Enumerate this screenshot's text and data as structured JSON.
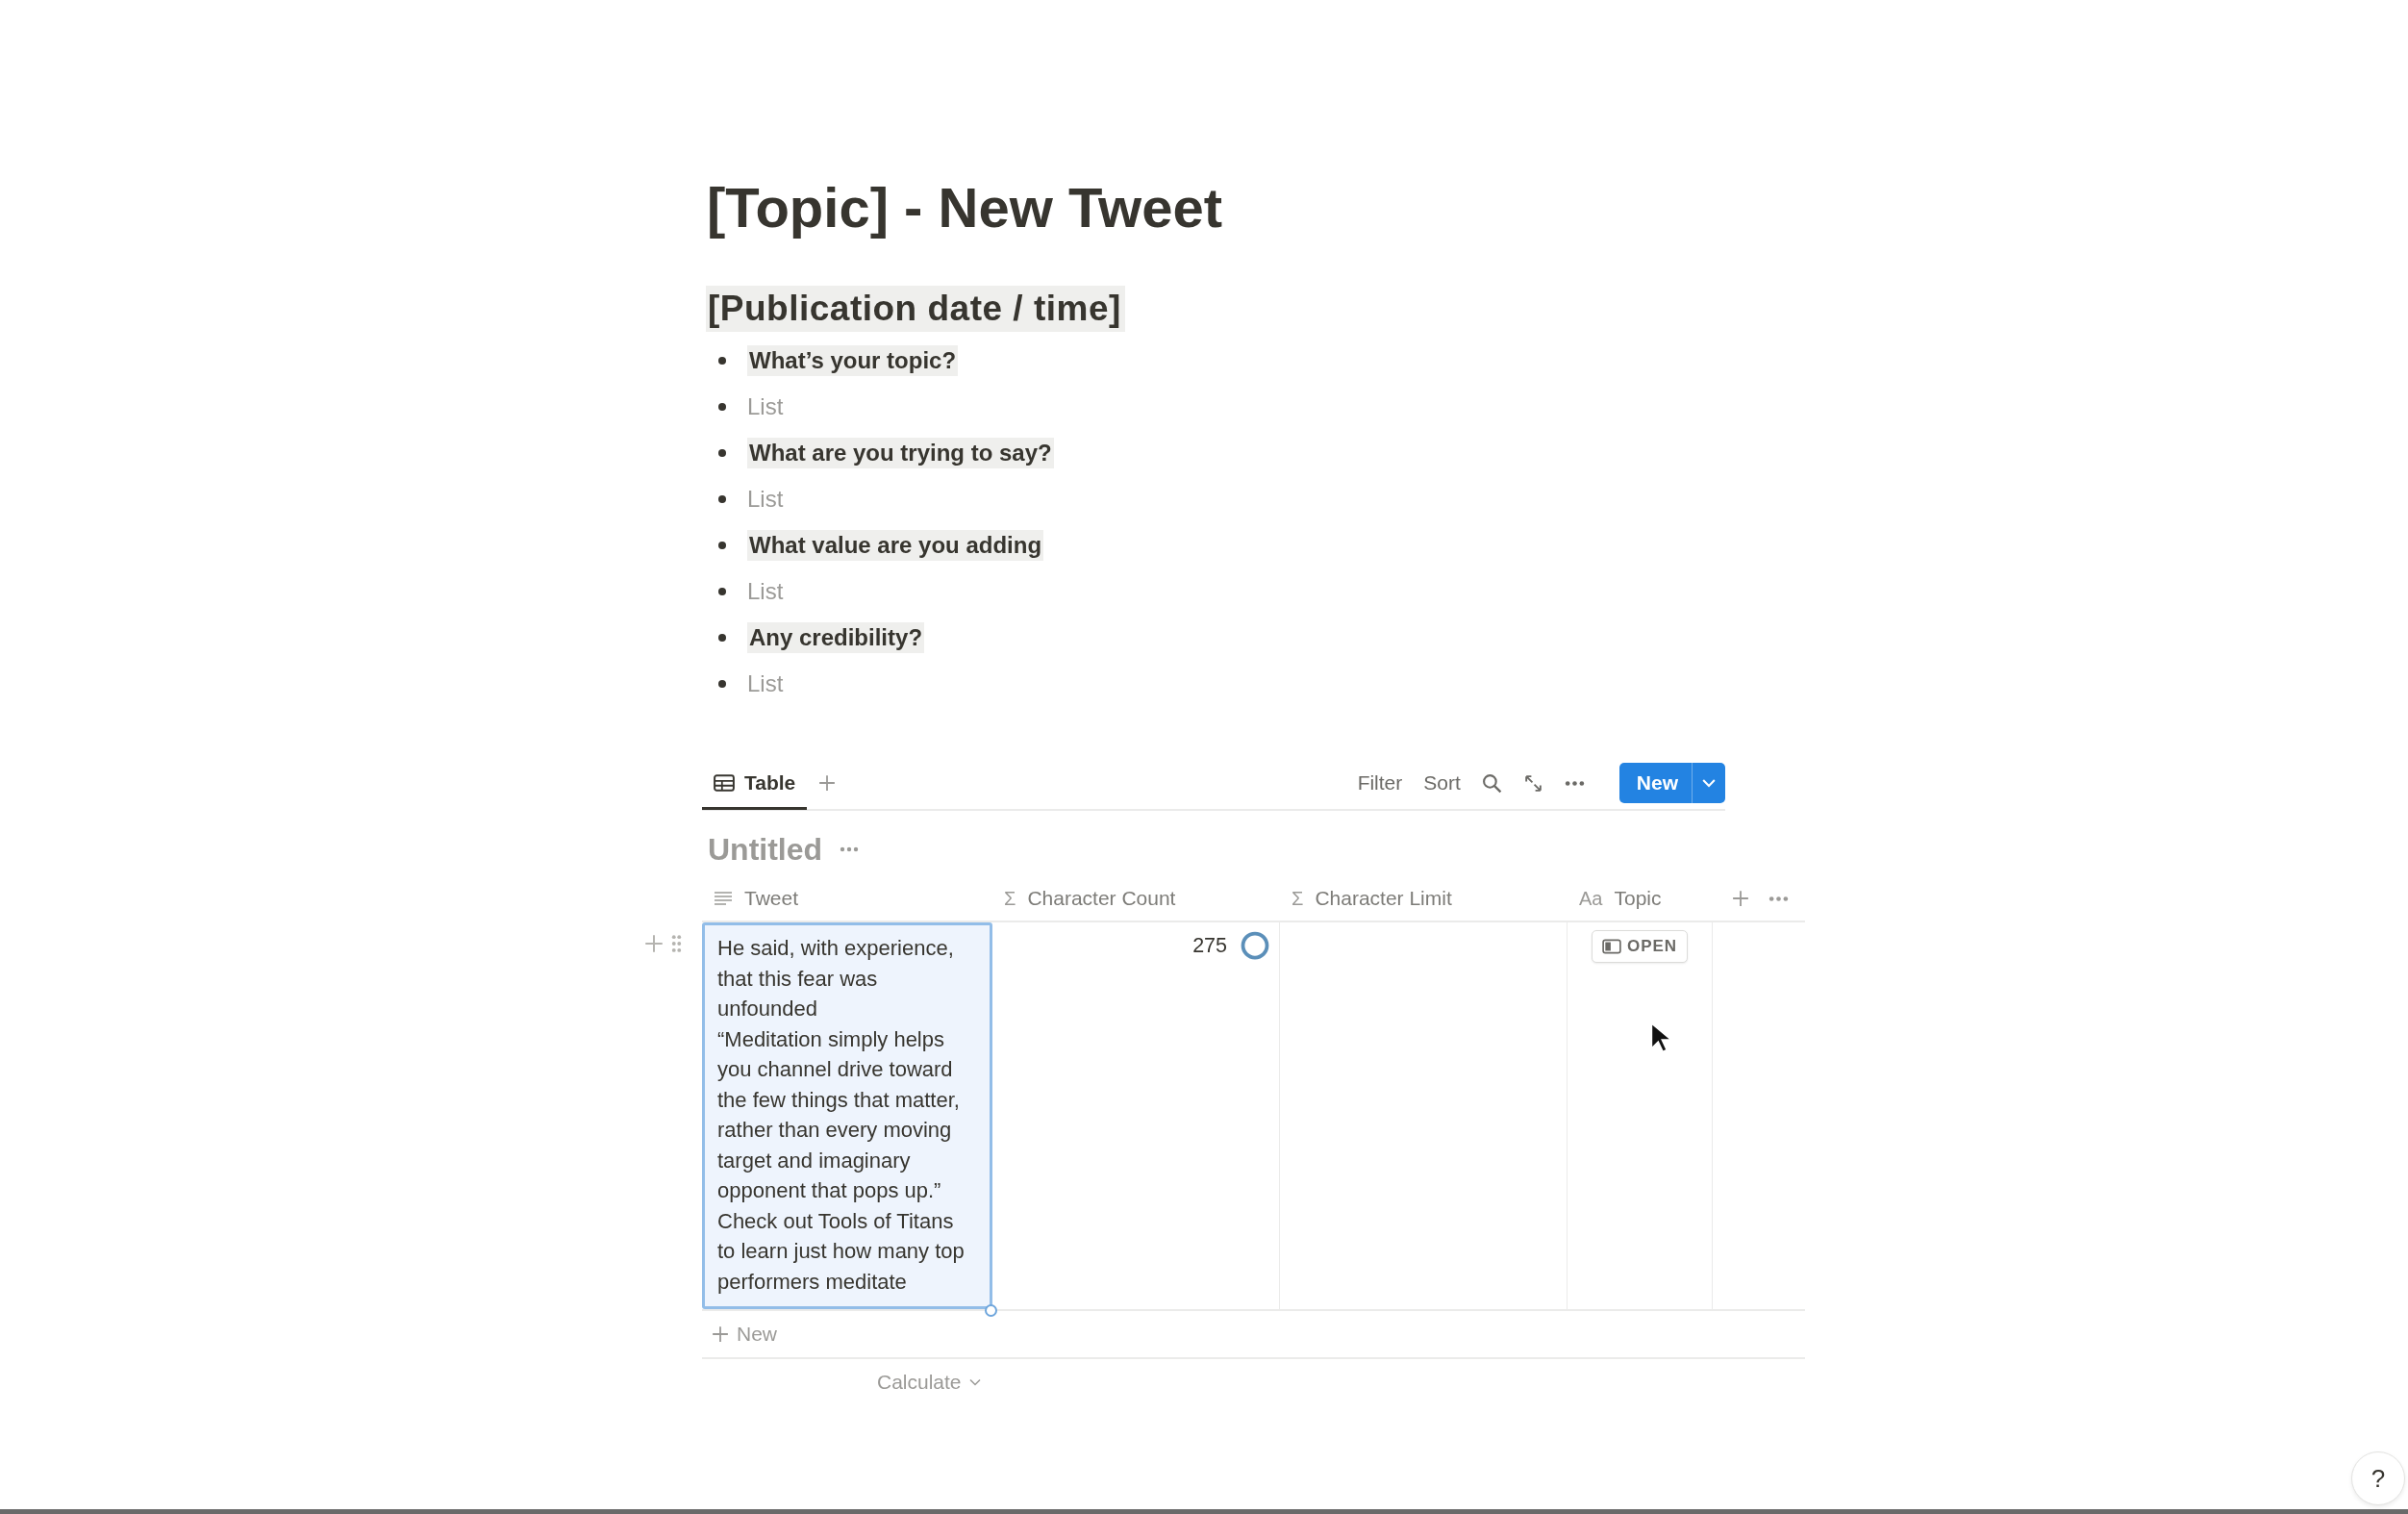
{
  "page": {
    "title": "[Topic] - New Tweet",
    "heading": "[Publication date / time]"
  },
  "bullets": [
    {
      "kind": "question",
      "text": "What’s your topic?"
    },
    {
      "kind": "placeholder",
      "text": "List"
    },
    {
      "kind": "question",
      "text": "What are you trying to say?"
    },
    {
      "kind": "placeholder",
      "text": "List"
    },
    {
      "kind": "question",
      "text": "What value are you adding "
    },
    {
      "kind": "placeholder",
      "text": "List"
    },
    {
      "kind": "question",
      "text": "Any credibility?"
    },
    {
      "kind": "placeholder",
      "text": "List"
    }
  ],
  "database": {
    "views": [
      {
        "label": "Table",
        "selected": true
      }
    ],
    "toolbar": [
      "Filter",
      "Sort"
    ],
    "new_button": "New",
    "title": "Untitled",
    "columns": [
      {
        "kind": "text",
        "label": "Tweet"
      },
      {
        "kind": "formula",
        "icon": "Σ",
        "label": "Character Count"
      },
      {
        "kind": "formula",
        "icon": "Σ",
        "label": "Character Limit"
      },
      {
        "kind": "title",
        "icon": "Aa",
        "label": "Topic"
      }
    ],
    "rows": [
      {
        "selected": true,
        "tweet": "He said, with experience, that this fear was unfounded\n“Meditation simply helps you channel drive toward the few things that matter, rather than every moving target and imaginary opponent that pops up.”\nCheck out Tools of Titans to learn just how many top performers meditate",
        "character_count": "275",
        "open_label": "OPEN"
      }
    ],
    "new_row": "New",
    "footer": "Calculate"
  },
  "help": "?"
}
